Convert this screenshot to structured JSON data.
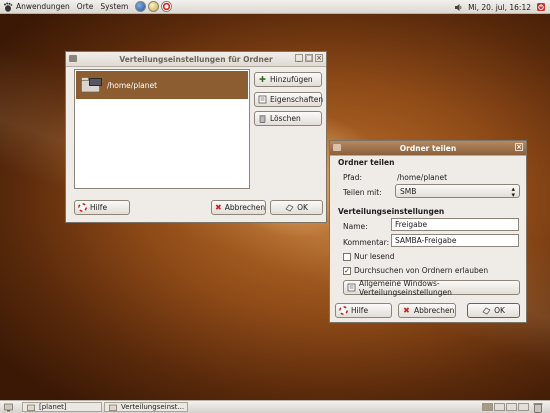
{
  "top_panel": {
    "menus": [
      "Anwendungen",
      "Orte",
      "System"
    ],
    "clock": "Mi, 20. jul, 16:12"
  },
  "bottom_panel": {
    "tasks": [
      "[planet]",
      "Verteilungseinst..."
    ]
  },
  "main_window": {
    "title": "Verteilungseinstellungen für Ordner",
    "list_items": [
      "/home/planet"
    ],
    "buttons": {
      "add": "Hinzufügen",
      "properties": "Eigenschaften",
      "delete": "Löschen",
      "help": "Hilfe",
      "cancel": "Abbrechen",
      "ok": "OK"
    }
  },
  "share_dialog": {
    "title": "Ordner teilen",
    "section_folder": "Ordner teilen",
    "path_label": "Pfad:",
    "path_value": "/home/planet",
    "share_with_label": "Teilen mit:",
    "share_with_value": "SMB",
    "section_settings": "Verteilungseinstellungen",
    "name_label": "Name:",
    "name_value": "Freigabe",
    "comment_label": "Kommentar:",
    "comment_value": "SAMBA-Freigabe",
    "readonly_label": "Nur lesend",
    "readonly_checked": false,
    "browse_label": "Durchsuchen von Ordnern erlauben",
    "browse_checked": true,
    "windows_settings_button": "Allgemeine Windows-Verteilungseinstellungen",
    "buttons": {
      "help": "Hilfe",
      "cancel": "Abbrechen",
      "ok": "OK"
    }
  },
  "colors": {
    "selection": "#8d5d32",
    "active_titlebar": "#9b7049",
    "desktop": "#8e4a17"
  }
}
